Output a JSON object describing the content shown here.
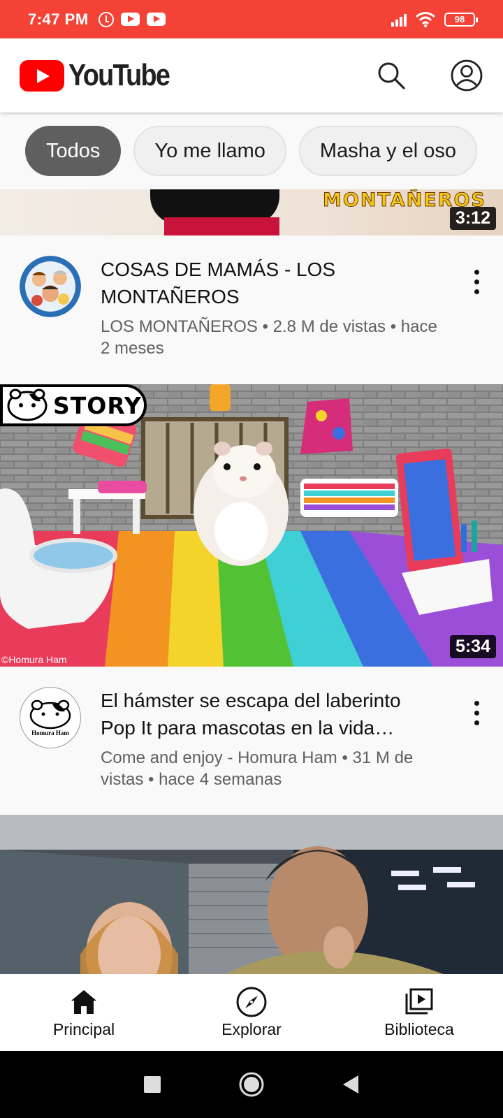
{
  "status_bar": {
    "time": "7:47 PM",
    "battery": "98",
    "icons": [
      "alarm-icon",
      "youtube-notification-icon",
      "youtube-notification-icon",
      "signal-icon",
      "wifi-icon",
      "battery-icon"
    ]
  },
  "header": {
    "logo_text": "YouTube",
    "actions": [
      "search-icon",
      "account-icon"
    ]
  },
  "chips": [
    {
      "label": "Todos",
      "active": true
    },
    {
      "label": "Yo me llamo",
      "active": false
    },
    {
      "label": "Masha y el oso",
      "active": false
    }
  ],
  "videos": [
    {
      "thumbnail_text": "MONTAÑEROS",
      "duration": "3:12",
      "title": "COSAS DE MAMÁS - LOS MONTAÑEROS",
      "channel": "LOS MONTAÑEROS",
      "subtitle": "LOS MONTAÑEROS • 2.8 M de vistas • hace 2 meses"
    },
    {
      "thumbnail_badge": "STORY",
      "thumbnail_credit": "©Homura Ham",
      "duration": "5:34",
      "title": "El hámster se escapa del laberinto Pop It para mascotas en la vida…",
      "channel": "Homura Ham",
      "subtitle": "Come and enjoy - Homura Ham • 31 M de vistas • hace 4 semanas"
    },
    {
      "title": "",
      "duration": ""
    }
  ],
  "bottom_nav": [
    {
      "label": "Principal",
      "icon": "home-icon",
      "active": true
    },
    {
      "label": "Explorar",
      "icon": "compass-icon",
      "active": false
    },
    {
      "label": "Biblioteca",
      "icon": "library-icon",
      "active": false
    }
  ],
  "colors": {
    "status_bar": "#f44336",
    "brand_red": "#ff0000",
    "active_chip": "#5f5f5f"
  }
}
